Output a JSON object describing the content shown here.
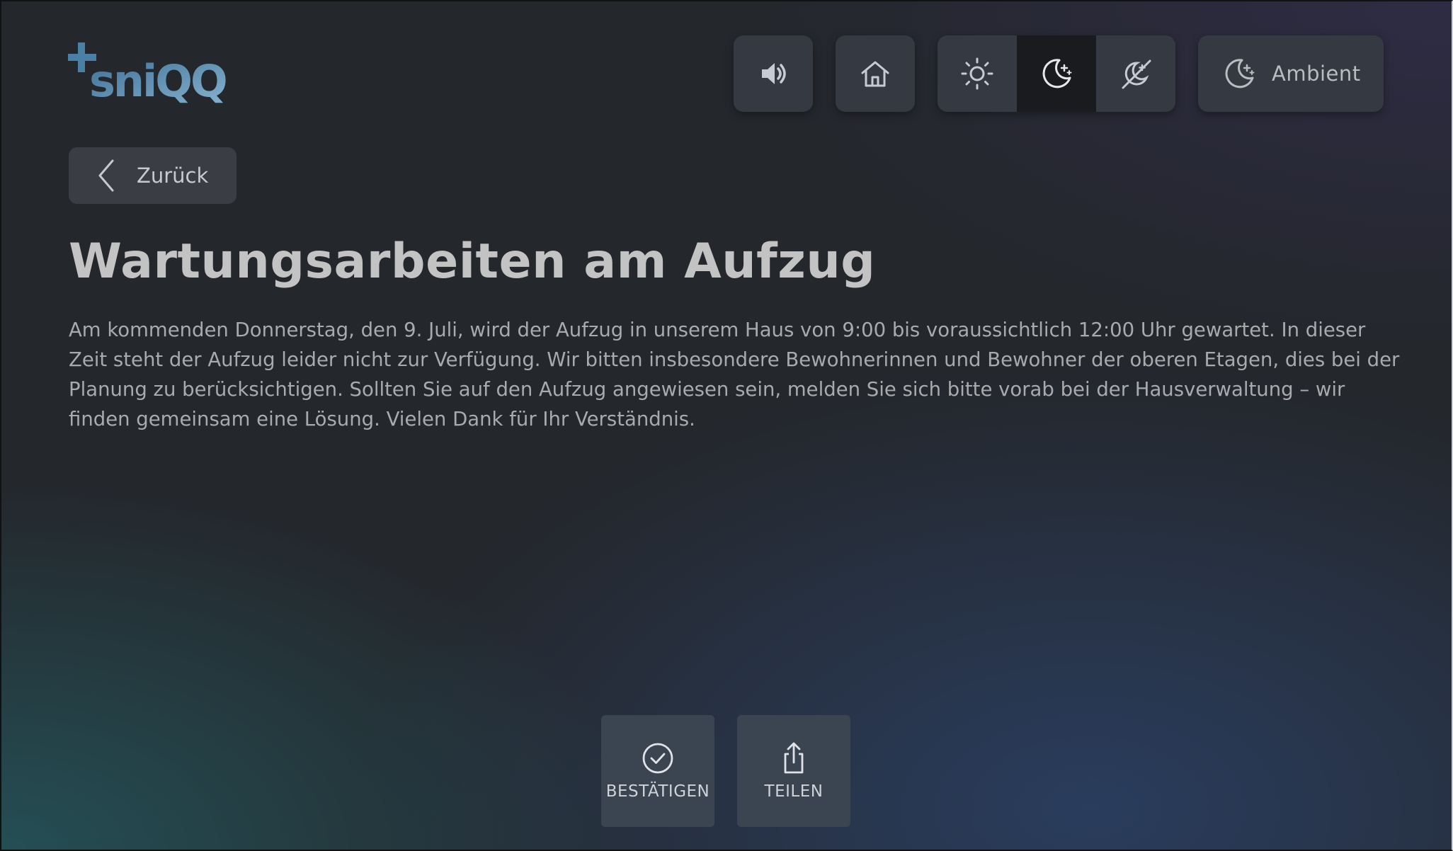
{
  "logo": {
    "text": "sniQQ",
    "name": "sniqq-logo"
  },
  "toolbar": {
    "sound": {
      "icon": "speaker-icon"
    },
    "home": {
      "icon": "home-icon"
    },
    "theme_modes": [
      {
        "icon": "sun-icon",
        "active": false
      },
      {
        "icon": "moon-stars-icon",
        "active": true
      },
      {
        "icon": "moon-sun-off-icon",
        "active": false
      }
    ],
    "ambient": {
      "icon": "moon-stars-icon",
      "label": "Ambient"
    }
  },
  "back": {
    "label": "Zurück",
    "icon": "chevron-left-icon"
  },
  "article": {
    "title": "Wartungsarbeiten am Aufzug",
    "body": "Am kommenden Donnerstag, den 9. Juli, wird der Aufzug in unserem Haus von 9:00 bis voraussichtlich 12:00 Uhr gewartet. In dieser Zeit steht der Aufzug leider nicht zur Verfügung. Wir bitten insbesondere Bewohnerinnen und Bewohner der oberen Etagen, dies bei der Planung zu berücksichtigen. Sollten Sie auf den Aufzug angewiesen sein, melden Sie sich bitte vorab bei der Hausverwaltung – wir finden gemeinsam eine Lösung. Vielen Dank für Ihr Verständnis."
  },
  "actions": {
    "confirm": {
      "label": "BESTÄTIGEN",
      "icon": "check-circle-icon"
    },
    "share": {
      "label": "TEILEN",
      "icon": "share-icon"
    }
  },
  "colors": {
    "tile": "#353a42",
    "tile_active": "#191b1f",
    "logo_blue": "#5a86a8",
    "text": "#c3c3c3"
  }
}
